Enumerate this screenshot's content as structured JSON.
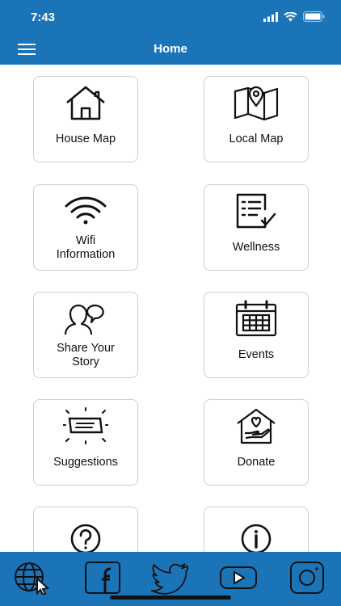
{
  "status": {
    "time": "7:43"
  },
  "header": {
    "title": "Home",
    "menu_icon": "hamburger-icon"
  },
  "tiles": [
    {
      "label": "House Map",
      "icon": "house-icon"
    },
    {
      "label": "Local Map",
      "icon": "map-pin-icon"
    },
    {
      "label": "Wifi\nInformation",
      "icon": "wifi-icon"
    },
    {
      "label": "Wellness",
      "icon": "checklist-icon"
    },
    {
      "label": "Share Your\nStory",
      "icon": "speech-person-icon"
    },
    {
      "label": "Events",
      "icon": "calendar-icon"
    },
    {
      "label": "Suggestions",
      "icon": "suggestion-box-icon"
    },
    {
      "label": "Donate",
      "icon": "donate-heart-icon"
    },
    {
      "label": "",
      "icon": "question-icon"
    },
    {
      "label": "",
      "icon": "info-icon"
    }
  ],
  "bottom_bar": {
    "items": [
      {
        "icon": "globe-cursor-icon"
      },
      {
        "icon": "facebook-icon"
      },
      {
        "icon": "twitter-icon"
      },
      {
        "icon": "youtube-icon"
      },
      {
        "icon": "instagram-icon"
      }
    ]
  },
  "colors": {
    "brand": "#1c74b8",
    "tile_border": "#cfcfcf"
  }
}
